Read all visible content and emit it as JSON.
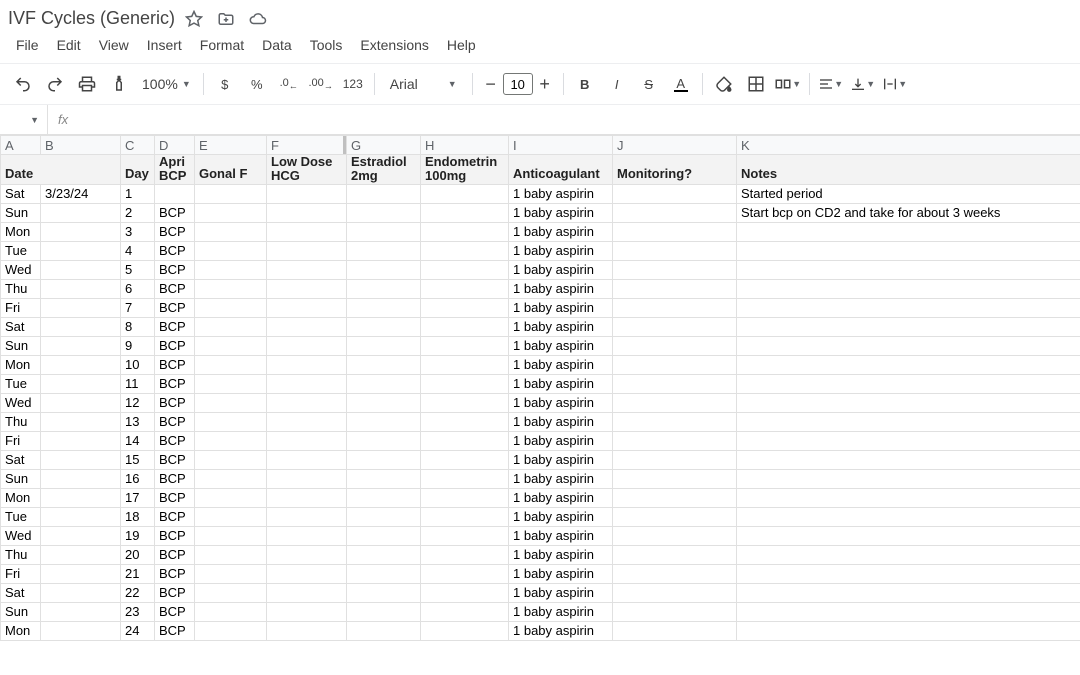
{
  "doc": {
    "title": "IVF Cycles (Generic)"
  },
  "menu": [
    "File",
    "Edit",
    "View",
    "Insert",
    "Format",
    "Data",
    "Tools",
    "Extensions",
    "Help"
  ],
  "toolbar": {
    "zoom": "100%",
    "font": "Arial",
    "fontSize": "10",
    "numFmt": "123",
    "currency": "$",
    "percent": "%"
  },
  "formula": {
    "fx": "fx"
  },
  "columns": [
    "A",
    "B",
    "C",
    "D",
    "E",
    "F",
    "G",
    "H",
    "I",
    "J",
    "K"
  ],
  "headers": {
    "date": "Date",
    "day": "Day",
    "bcp_top": "Apri",
    "bcp": "BCP",
    "gonal": "Gonal F",
    "hcg_top": "Low Dose",
    "hcg": "HCG",
    "estradiol_top": "Estradiol",
    "estradiol": "2mg",
    "endometrin_top": "Endometrin",
    "endometrin": "100mg",
    "anticoag": "Anticoagulant",
    "monitoring": "Monitoring?",
    "notes": "Notes"
  },
  "rows": [
    {
      "dow": "Sat",
      "date": "3/23/24",
      "day": "1",
      "bcp": "",
      "anticoag": "1 baby aspirin",
      "notes": "Started period"
    },
    {
      "dow": "Sun",
      "date": "",
      "day": "2",
      "bcp": "BCP",
      "anticoag": "1 baby aspirin",
      "notes": "Start bcp on CD2 and take for about 3 weeks"
    },
    {
      "dow": "Mon",
      "date": "",
      "day": "3",
      "bcp": "BCP",
      "anticoag": "1 baby aspirin",
      "notes": ""
    },
    {
      "dow": "Tue",
      "date": "",
      "day": "4",
      "bcp": "BCP",
      "anticoag": "1 baby aspirin",
      "notes": ""
    },
    {
      "dow": "Wed",
      "date": "",
      "day": "5",
      "bcp": "BCP",
      "anticoag": "1 baby aspirin",
      "notes": ""
    },
    {
      "dow": "Thu",
      "date": "",
      "day": "6",
      "bcp": "BCP",
      "anticoag": "1 baby aspirin",
      "notes": ""
    },
    {
      "dow": "Fri",
      "date": "",
      "day": "7",
      "bcp": "BCP",
      "anticoag": "1 baby aspirin",
      "notes": ""
    },
    {
      "dow": "Sat",
      "date": "",
      "day": "8",
      "bcp": "BCP",
      "anticoag": "1 baby aspirin",
      "notes": ""
    },
    {
      "dow": "Sun",
      "date": "",
      "day": "9",
      "bcp": "BCP",
      "anticoag": "1 baby aspirin",
      "notes": ""
    },
    {
      "dow": "Mon",
      "date": "",
      "day": "10",
      "bcp": "BCP",
      "anticoag": "1 baby aspirin",
      "notes": ""
    },
    {
      "dow": "Tue",
      "date": "",
      "day": "11",
      "bcp": "BCP",
      "anticoag": "1 baby aspirin",
      "notes": ""
    },
    {
      "dow": "Wed",
      "date": "",
      "day": "12",
      "bcp": "BCP",
      "anticoag": "1 baby aspirin",
      "notes": ""
    },
    {
      "dow": "Thu",
      "date": "",
      "day": "13",
      "bcp": "BCP",
      "anticoag": "1 baby aspirin",
      "notes": ""
    },
    {
      "dow": "Fri",
      "date": "",
      "day": "14",
      "bcp": "BCP",
      "anticoag": "1 baby aspirin",
      "notes": ""
    },
    {
      "dow": "Sat",
      "date": "",
      "day": "15",
      "bcp": "BCP",
      "anticoag": "1 baby aspirin",
      "notes": ""
    },
    {
      "dow": "Sun",
      "date": "",
      "day": "16",
      "bcp": "BCP",
      "anticoag": "1 baby aspirin",
      "notes": ""
    },
    {
      "dow": "Mon",
      "date": "",
      "day": "17",
      "bcp": "BCP",
      "anticoag": "1 baby aspirin",
      "notes": ""
    },
    {
      "dow": "Tue",
      "date": "",
      "day": "18",
      "bcp": "BCP",
      "anticoag": "1 baby aspirin",
      "notes": ""
    },
    {
      "dow": "Wed",
      "date": "",
      "day": "19",
      "bcp": "BCP",
      "anticoag": "1 baby aspirin",
      "notes": ""
    },
    {
      "dow": "Thu",
      "date": "",
      "day": "20",
      "bcp": "BCP",
      "anticoag": "1 baby aspirin",
      "notes": ""
    },
    {
      "dow": "Fri",
      "date": "",
      "day": "21",
      "bcp": "BCP",
      "anticoag": "1 baby aspirin",
      "notes": ""
    },
    {
      "dow": "Sat",
      "date": "",
      "day": "22",
      "bcp": "BCP",
      "anticoag": "1 baby aspirin",
      "notes": ""
    },
    {
      "dow": "Sun",
      "date": "",
      "day": "23",
      "bcp": "BCP",
      "anticoag": "1 baby aspirin",
      "notes": ""
    },
    {
      "dow": "Mon",
      "date": "",
      "day": "24",
      "bcp": "BCP",
      "anticoag": "1 baby aspirin",
      "notes": ""
    }
  ]
}
